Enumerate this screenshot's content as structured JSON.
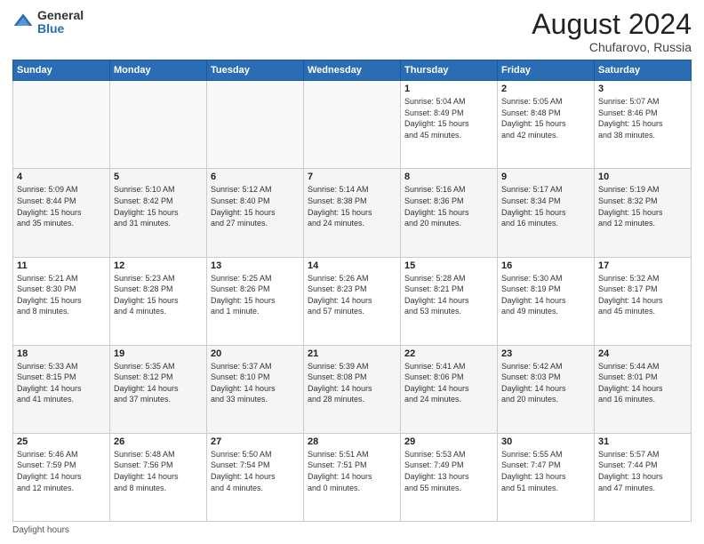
{
  "header": {
    "logo_general": "General",
    "logo_blue": "Blue",
    "month_year": "August 2024",
    "location": "Chufarovo, Russia"
  },
  "footer": {
    "note": "Daylight hours"
  },
  "days_of_week": [
    "Sunday",
    "Monday",
    "Tuesday",
    "Wednesday",
    "Thursday",
    "Friday",
    "Saturday"
  ],
  "weeks": [
    [
      {
        "day": "",
        "info": ""
      },
      {
        "day": "",
        "info": ""
      },
      {
        "day": "",
        "info": ""
      },
      {
        "day": "",
        "info": ""
      },
      {
        "day": "1",
        "info": "Sunrise: 5:04 AM\nSunset: 8:49 PM\nDaylight: 15 hours\nand 45 minutes."
      },
      {
        "day": "2",
        "info": "Sunrise: 5:05 AM\nSunset: 8:48 PM\nDaylight: 15 hours\nand 42 minutes."
      },
      {
        "day": "3",
        "info": "Sunrise: 5:07 AM\nSunset: 8:46 PM\nDaylight: 15 hours\nand 38 minutes."
      }
    ],
    [
      {
        "day": "4",
        "info": "Sunrise: 5:09 AM\nSunset: 8:44 PM\nDaylight: 15 hours\nand 35 minutes."
      },
      {
        "day": "5",
        "info": "Sunrise: 5:10 AM\nSunset: 8:42 PM\nDaylight: 15 hours\nand 31 minutes."
      },
      {
        "day": "6",
        "info": "Sunrise: 5:12 AM\nSunset: 8:40 PM\nDaylight: 15 hours\nand 27 minutes."
      },
      {
        "day": "7",
        "info": "Sunrise: 5:14 AM\nSunset: 8:38 PM\nDaylight: 15 hours\nand 24 minutes."
      },
      {
        "day": "8",
        "info": "Sunrise: 5:16 AM\nSunset: 8:36 PM\nDaylight: 15 hours\nand 20 minutes."
      },
      {
        "day": "9",
        "info": "Sunrise: 5:17 AM\nSunset: 8:34 PM\nDaylight: 15 hours\nand 16 minutes."
      },
      {
        "day": "10",
        "info": "Sunrise: 5:19 AM\nSunset: 8:32 PM\nDaylight: 15 hours\nand 12 minutes."
      }
    ],
    [
      {
        "day": "11",
        "info": "Sunrise: 5:21 AM\nSunset: 8:30 PM\nDaylight: 15 hours\nand 8 minutes."
      },
      {
        "day": "12",
        "info": "Sunrise: 5:23 AM\nSunset: 8:28 PM\nDaylight: 15 hours\nand 4 minutes."
      },
      {
        "day": "13",
        "info": "Sunrise: 5:25 AM\nSunset: 8:26 PM\nDaylight: 15 hours\nand 1 minute."
      },
      {
        "day": "14",
        "info": "Sunrise: 5:26 AM\nSunset: 8:23 PM\nDaylight: 14 hours\nand 57 minutes."
      },
      {
        "day": "15",
        "info": "Sunrise: 5:28 AM\nSunset: 8:21 PM\nDaylight: 14 hours\nand 53 minutes."
      },
      {
        "day": "16",
        "info": "Sunrise: 5:30 AM\nSunset: 8:19 PM\nDaylight: 14 hours\nand 49 minutes."
      },
      {
        "day": "17",
        "info": "Sunrise: 5:32 AM\nSunset: 8:17 PM\nDaylight: 14 hours\nand 45 minutes."
      }
    ],
    [
      {
        "day": "18",
        "info": "Sunrise: 5:33 AM\nSunset: 8:15 PM\nDaylight: 14 hours\nand 41 minutes."
      },
      {
        "day": "19",
        "info": "Sunrise: 5:35 AM\nSunset: 8:12 PM\nDaylight: 14 hours\nand 37 minutes."
      },
      {
        "day": "20",
        "info": "Sunrise: 5:37 AM\nSunset: 8:10 PM\nDaylight: 14 hours\nand 33 minutes."
      },
      {
        "day": "21",
        "info": "Sunrise: 5:39 AM\nSunset: 8:08 PM\nDaylight: 14 hours\nand 28 minutes."
      },
      {
        "day": "22",
        "info": "Sunrise: 5:41 AM\nSunset: 8:06 PM\nDaylight: 14 hours\nand 24 minutes."
      },
      {
        "day": "23",
        "info": "Sunrise: 5:42 AM\nSunset: 8:03 PM\nDaylight: 14 hours\nand 20 minutes."
      },
      {
        "day": "24",
        "info": "Sunrise: 5:44 AM\nSunset: 8:01 PM\nDaylight: 14 hours\nand 16 minutes."
      }
    ],
    [
      {
        "day": "25",
        "info": "Sunrise: 5:46 AM\nSunset: 7:59 PM\nDaylight: 14 hours\nand 12 minutes."
      },
      {
        "day": "26",
        "info": "Sunrise: 5:48 AM\nSunset: 7:56 PM\nDaylight: 14 hours\nand 8 minutes."
      },
      {
        "day": "27",
        "info": "Sunrise: 5:50 AM\nSunset: 7:54 PM\nDaylight: 14 hours\nand 4 minutes."
      },
      {
        "day": "28",
        "info": "Sunrise: 5:51 AM\nSunset: 7:51 PM\nDaylight: 14 hours\nand 0 minutes."
      },
      {
        "day": "29",
        "info": "Sunrise: 5:53 AM\nSunset: 7:49 PM\nDaylight: 13 hours\nand 55 minutes."
      },
      {
        "day": "30",
        "info": "Sunrise: 5:55 AM\nSunset: 7:47 PM\nDaylight: 13 hours\nand 51 minutes."
      },
      {
        "day": "31",
        "info": "Sunrise: 5:57 AM\nSunset: 7:44 PM\nDaylight: 13 hours\nand 47 minutes."
      }
    ]
  ]
}
